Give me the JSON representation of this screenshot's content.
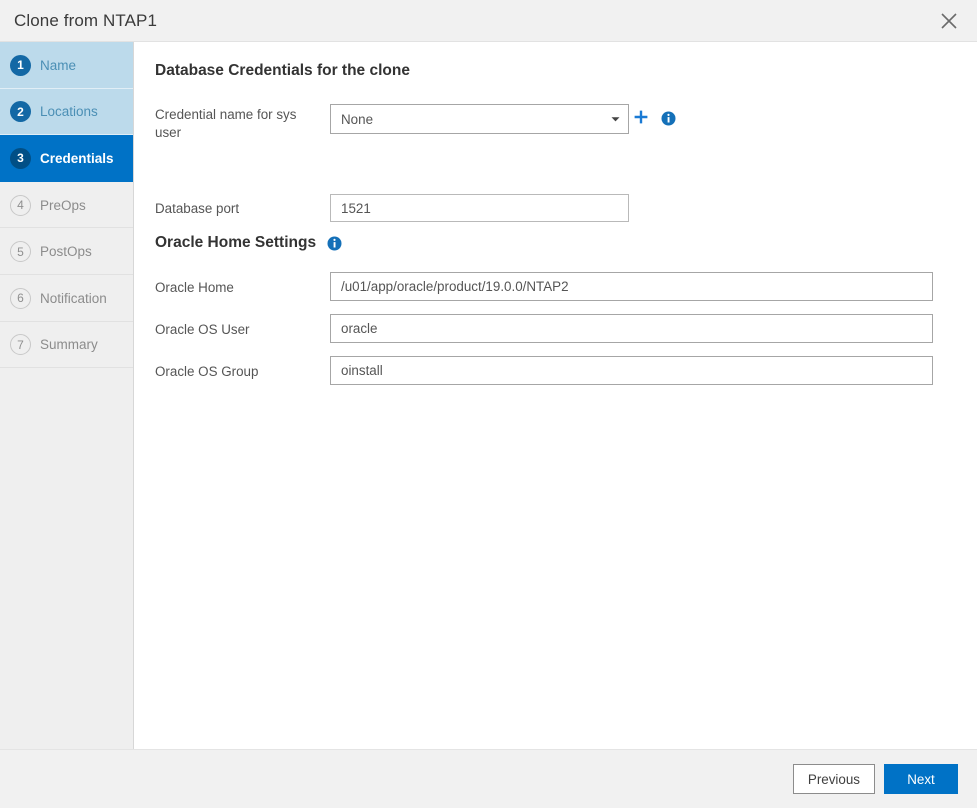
{
  "window": {
    "title": "Clone from NTAP1",
    "close_label": "close-icon"
  },
  "sidebar": {
    "steps": [
      {
        "num": "1",
        "label": "Name",
        "state": "done"
      },
      {
        "num": "2",
        "label": "Locations",
        "state": "done"
      },
      {
        "num": "3",
        "label": "Credentials",
        "state": "active"
      },
      {
        "num": "4",
        "label": "PreOps",
        "state": "todo"
      },
      {
        "num": "5",
        "label": "PostOps",
        "state": "todo"
      },
      {
        "num": "6",
        "label": "Notification",
        "state": "todo"
      },
      {
        "num": "7",
        "label": "Summary",
        "state": "todo"
      }
    ]
  },
  "main": {
    "db_section": {
      "heading": "Database Credentials for the clone",
      "credential_label": "Credential name for sys user",
      "credential_value": "None",
      "port_label": "Database port",
      "port_value": "1521"
    },
    "oracle_section": {
      "heading": "Oracle Home Settings",
      "home_label": "Oracle Home",
      "home_value": "/u01/app/oracle/product/19.0.0/NTAP2",
      "os_user_label": "Oracle OS User",
      "os_user_value": "oracle",
      "os_group_label": "Oracle OS Group",
      "os_group_value": "oinstall"
    }
  },
  "footer": {
    "previous_label": "Previous",
    "next_label": "Next"
  },
  "colors": {
    "accent": "#0072c6",
    "accent_dark": "#014f86",
    "step_done_bg": "#bcdaeb",
    "titlebar_bg": "#f1f1f1",
    "sidebar_bg": "#efefef"
  }
}
